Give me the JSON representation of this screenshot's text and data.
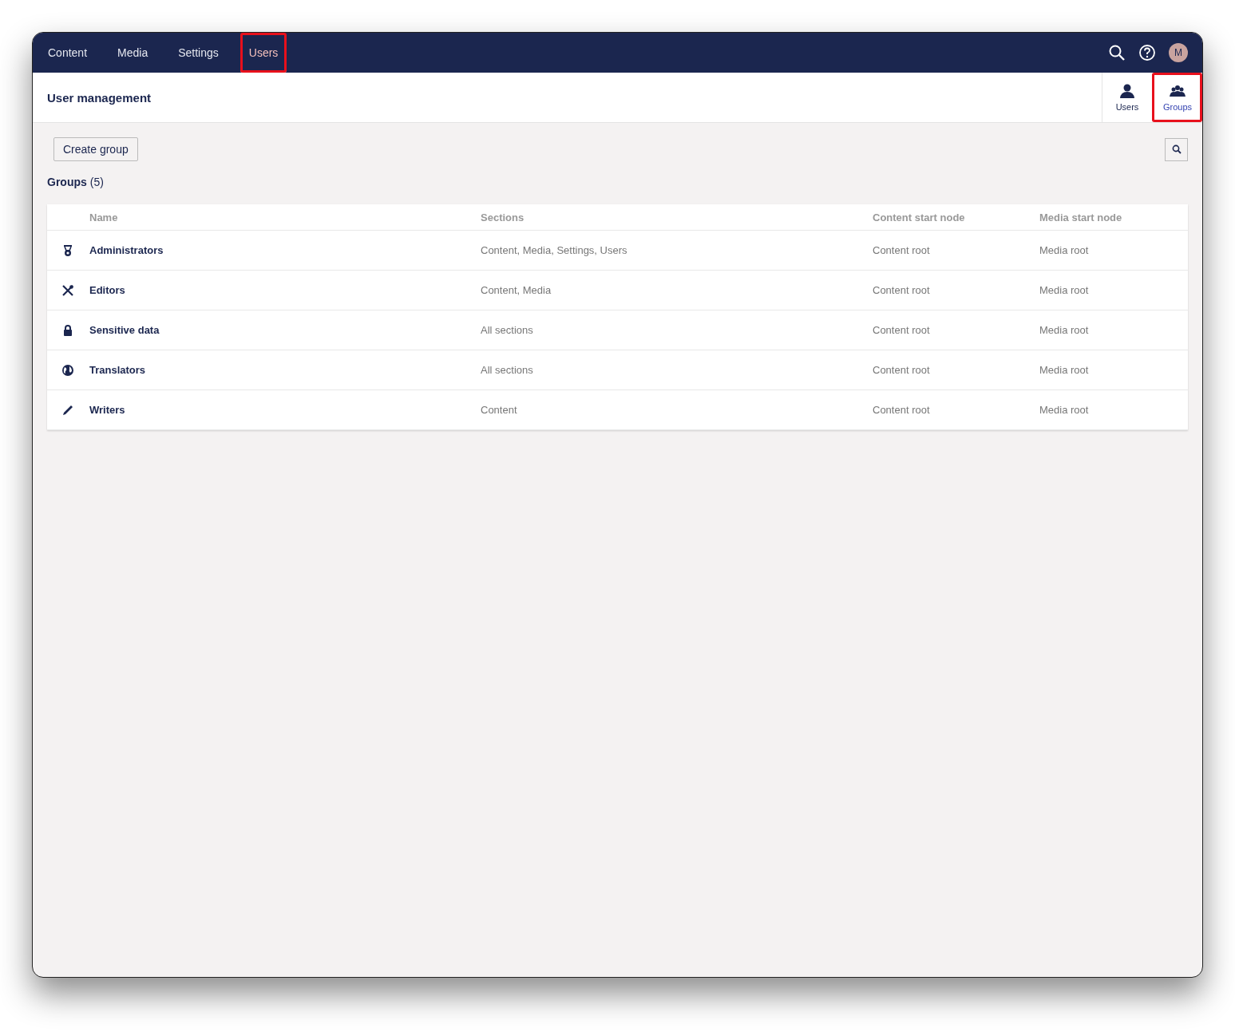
{
  "top_nav": {
    "sections": [
      {
        "label": "Content",
        "selected": false,
        "highlighted": false
      },
      {
        "label": "Media",
        "selected": false,
        "highlighted": false
      },
      {
        "label": "Settings",
        "selected": false,
        "highlighted": false
      },
      {
        "label": "Users",
        "selected": true,
        "highlighted": true
      }
    ],
    "avatar_initial": "M"
  },
  "header": {
    "title": "User management",
    "views": [
      {
        "label": "Users",
        "kind": "user",
        "selected": false,
        "highlighted": false
      },
      {
        "label": "Groups",
        "kind": "group",
        "selected": true,
        "highlighted": true
      }
    ]
  },
  "toolbar": {
    "create_button": "Create group"
  },
  "groups_heading": {
    "label": "Groups",
    "count": "(5)"
  },
  "table": {
    "columns": [
      "Name",
      "Sections",
      "Content start node",
      "Media start node"
    ],
    "rows": [
      {
        "kind": "medal",
        "name": "Administrators",
        "sections": "Content, Media, Settings, Users",
        "content_start": "Content root",
        "media_start": "Media root"
      },
      {
        "kind": "tools",
        "name": "Editors",
        "sections": "Content, Media",
        "content_start": "Content root",
        "media_start": "Media root"
      },
      {
        "kind": "lock",
        "name": "Sensitive data",
        "sections": "All sections",
        "content_start": "Content root",
        "media_start": "Media root"
      },
      {
        "kind": "globe",
        "name": "Translators",
        "sections": "All sections",
        "content_start": "Content root",
        "media_start": "Media root"
      },
      {
        "kind": "pencil",
        "name": "Writers",
        "sections": "Content",
        "content_start": "Content root",
        "media_start": "Media root"
      }
    ]
  }
}
